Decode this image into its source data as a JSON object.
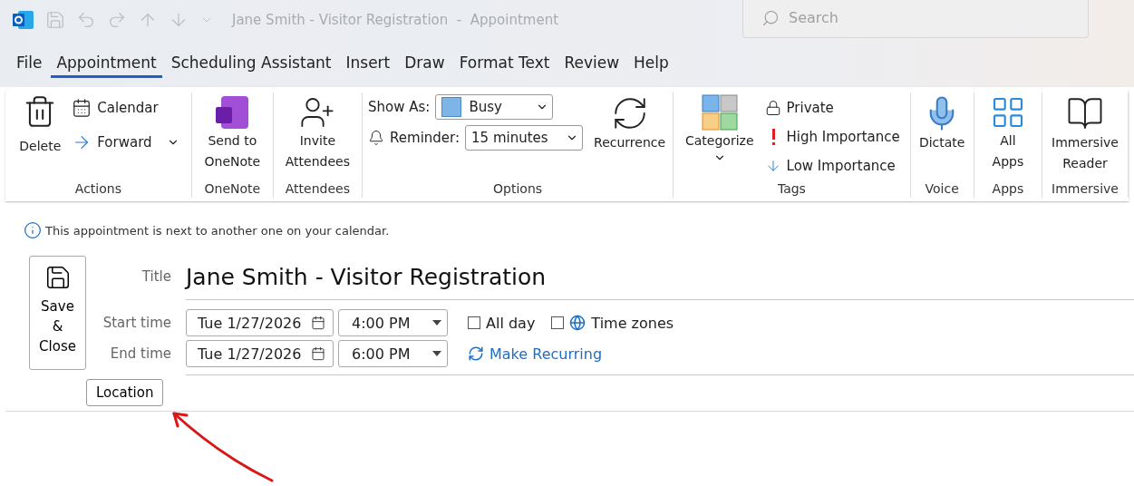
{
  "title_bar": {
    "title": "Jane Smith - Visitor Registration  -  Appointment",
    "search_placeholder": "Search"
  },
  "tabs": [
    {
      "label": "File",
      "selected": false
    },
    {
      "label": "Appointment",
      "selected": true
    },
    {
      "label": "Scheduling Assistant",
      "selected": false
    },
    {
      "label": "Insert",
      "selected": false
    },
    {
      "label": "Draw",
      "selected": false
    },
    {
      "label": "Format Text",
      "selected": false
    },
    {
      "label": "Review",
      "selected": false
    },
    {
      "label": "Help",
      "selected": false
    }
  ],
  "ribbon": [
    {
      "kind": "actions",
      "label": "Actions",
      "delete": "Delete",
      "calendar": "Calendar",
      "forward": "Forward"
    },
    {
      "kind": "onenote",
      "label": "OneNote",
      "button": "Send to OneNote"
    },
    {
      "kind": "attendees",
      "label": "Attendees",
      "button": "Invite Attendees"
    },
    {
      "kind": "options",
      "label": "Options",
      "show_as_label": "Show As:",
      "show_as": "Busy",
      "reminder_label": "Reminder:",
      "reminder": "15 minutes",
      "recurrence": "Recurrence"
    },
    {
      "kind": "tags",
      "label": "Tags",
      "categorize": "Categorize",
      "private": "Private",
      "high": "High Importance",
      "low": "Low Importance"
    },
    {
      "kind": "voice",
      "label": "Voice",
      "button": "Dictate"
    },
    {
      "kind": "apps",
      "label": "Apps",
      "button": "All Apps"
    },
    {
      "kind": "immersive",
      "label": "Immersive",
      "button": "Immersive Reader"
    }
  ],
  "info": "This appointment is next to another one on your calendar.",
  "form": {
    "save_close": "Save\n&\nClose",
    "title_label": "Title",
    "title": "Jane Smith - Visitor Registration",
    "start_label": "Start time",
    "start_date": "Tue 1/27/2026",
    "start_time": "4:00 PM",
    "end_label": "End time",
    "end_date": "Tue 1/27/2026",
    "end_time": "6:00 PM",
    "all_day": {
      "label": "All day",
      "checked": false
    },
    "time_zones": {
      "label": "Time zones",
      "checked": false
    },
    "make_recurring": "Make Recurring",
    "location": "Location"
  }
}
